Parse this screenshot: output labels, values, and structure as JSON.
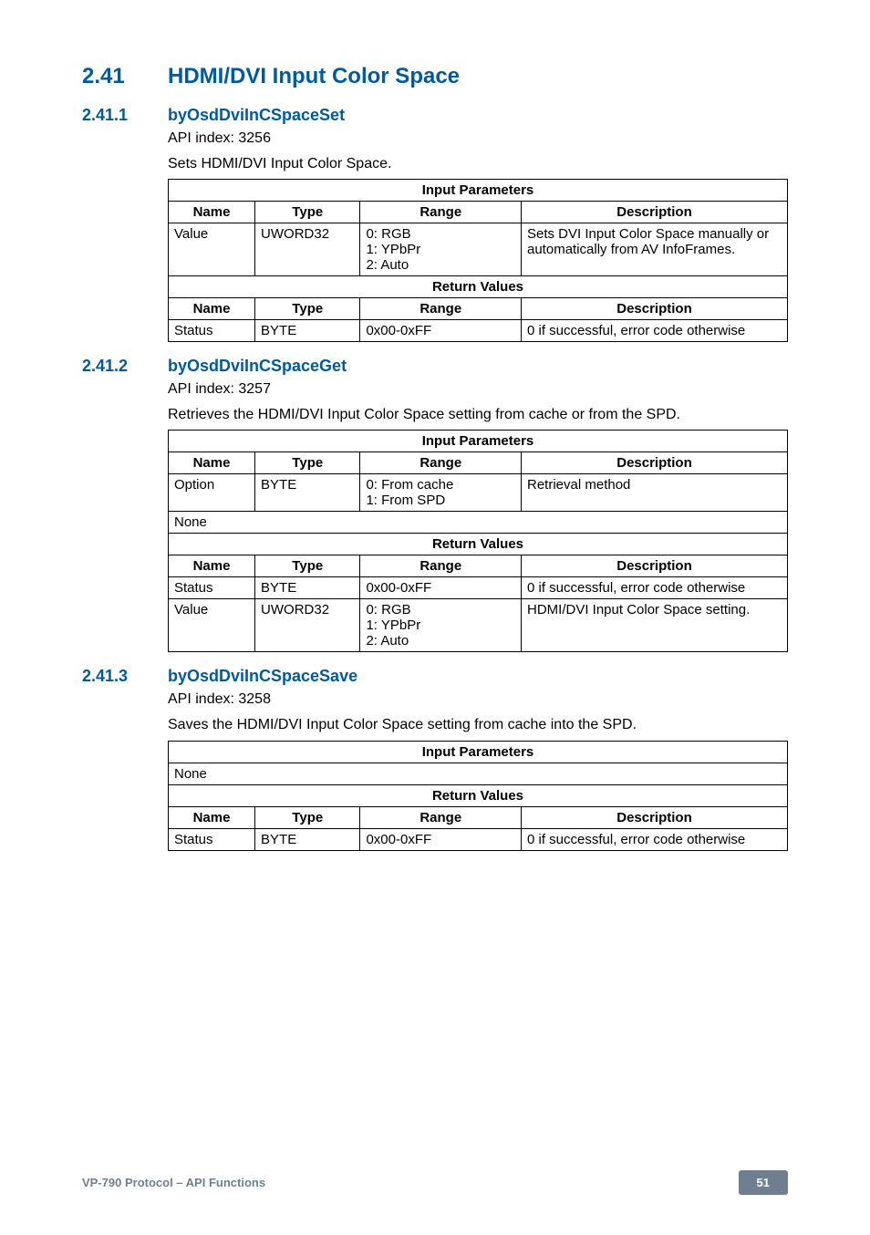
{
  "h1": {
    "num": "2.41",
    "title": "HDMI/DVI Input Color Space"
  },
  "s1": {
    "num": "2.41.1",
    "title": "byOsdDviInCSpaceSet",
    "api_index": "API index: 3256",
    "desc": "Sets HDMI/DVI Input Color Space.",
    "table": {
      "ip_header": "Input Parameters",
      "cols": {
        "name": "Name",
        "type": "Type",
        "range": "Range",
        "desc": "Description"
      },
      "ip_rows": [
        {
          "name": "Value",
          "type": "UWORD32",
          "range": "0: RGB\n1: YPbPr\n2: Auto",
          "desc": "Sets DVI Input Color Space manually or automatically from AV InfoFrames."
        }
      ],
      "rv_header": "Return Values",
      "rv_rows": [
        {
          "name": "Status",
          "type": "BYTE",
          "range": "0x00-0xFF",
          "desc": "0 if successful, error code otherwise"
        }
      ]
    }
  },
  "s2": {
    "num": "2.41.2",
    "title": "byOsdDviInCSpaceGet",
    "api_index": "API index: 3257",
    "desc": "Retrieves the HDMI/DVI Input Color Space setting from cache or from the SPD.",
    "table": {
      "ip_header": "Input Parameters",
      "cols": {
        "name": "Name",
        "type": "Type",
        "range": "Range",
        "desc": "Description"
      },
      "ip_rows": [
        {
          "name": "Option",
          "type": "BYTE",
          "range": "0: From cache\n1: From SPD",
          "desc": "Retrieval method"
        }
      ],
      "none": "None",
      "rv_header": "Return Values",
      "rv_rows": [
        {
          "name": "Status",
          "type": "BYTE",
          "range": "0x00-0xFF",
          "desc": "0 if successful, error code otherwise"
        },
        {
          "name": "Value",
          "type": "UWORD32",
          "range": "0: RGB\n1: YPbPr\n2: Auto",
          "desc": "HDMI/DVI Input Color Space setting."
        }
      ]
    }
  },
  "s3": {
    "num": "2.41.3",
    "title": "byOsdDviInCSpaceSave",
    "api_index": "API index: 3258",
    "desc": "Saves the HDMI/DVI Input Color Space setting from cache into the SPD.",
    "table": {
      "ip_header": "Input Parameters",
      "none": "None",
      "rv_header": "Return Values",
      "cols": {
        "name": "Name",
        "type": "Type",
        "range": "Range",
        "desc": "Description"
      },
      "rv_rows": [
        {
          "name": "Status",
          "type": "BYTE",
          "range": "0x00-0xFF",
          "desc": "0 if successful, error code otherwise"
        }
      ]
    }
  },
  "footer": {
    "left": "VP-790 Protocol –  API Functions",
    "page": "51"
  }
}
